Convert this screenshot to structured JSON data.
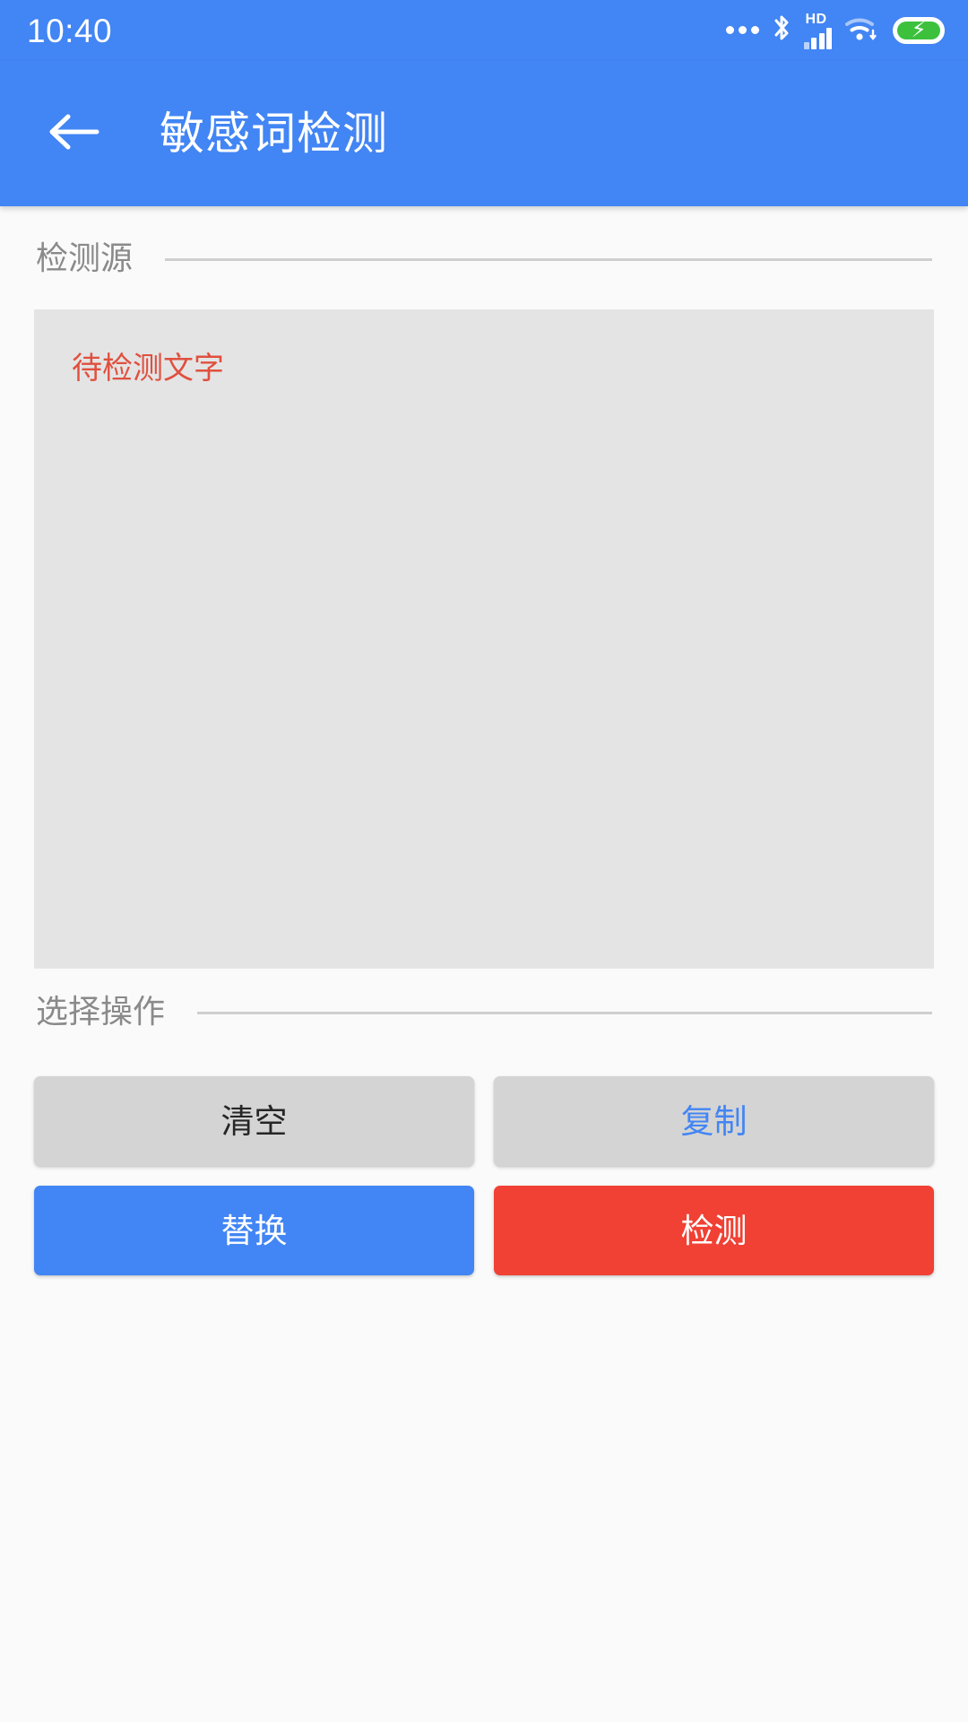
{
  "status_bar": {
    "time": "10:40",
    "icons": [
      {
        "name": "more-dots-icon",
        "label": "…"
      },
      {
        "name": "bluetooth-icon",
        "label": "bluetooth"
      },
      {
        "name": "hd-signal-icon",
        "label": "HD"
      },
      {
        "name": "wifi-icon",
        "label": "wifi"
      },
      {
        "name": "battery-charging-icon",
        "label": "charging"
      }
    ],
    "hd_label": "HD",
    "battery_bolt": "⚡",
    "background_color": "#4285F4"
  },
  "app_bar": {
    "back_icon": "arrow-left-icon",
    "title": "敏感词检测",
    "background_color": "#4285F4"
  },
  "sections": {
    "source": {
      "label": "检测源",
      "textarea": {
        "value": "",
        "placeholder": "待检测文字",
        "placeholder_color": "#E0503F",
        "background_color": "#E4E4E4"
      }
    },
    "operations": {
      "label": "选择操作",
      "buttons": [
        {
          "label": "清空",
          "style": "gray-dark",
          "name": "clear-button"
        },
        {
          "label": "复制",
          "style": "gray-blue",
          "name": "copy-button"
        },
        {
          "label": "替换",
          "style": "blue",
          "name": "replace-button"
        },
        {
          "label": "检测",
          "style": "red",
          "name": "detect-button"
        }
      ]
    }
  },
  "colors": {
    "primary": "#4285F4",
    "danger": "#F04134",
    "page_background": "#FAFAFA",
    "field_background": "#E4E4E4",
    "button_gray": "#D4D4D4",
    "label_gray": "#8A8A8A",
    "rule_gray": "#CFCFCF"
  }
}
